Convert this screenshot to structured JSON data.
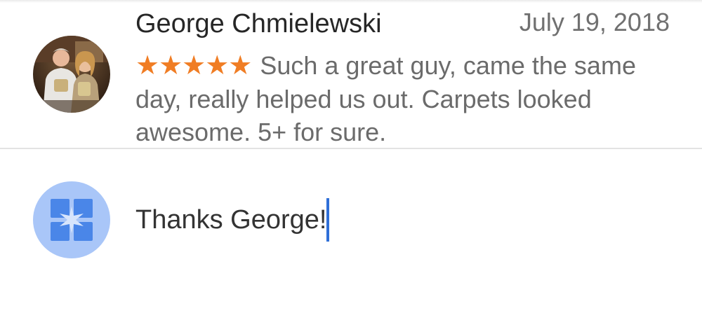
{
  "review": {
    "reviewer_name": "George Chmielewski",
    "date": "July 19, 2018",
    "rating": 5,
    "stars_text": "★★★★★",
    "body": "Such a great guy, came the same day, really helped us out.  Carpets looked awesome.  5+ for sure."
  },
  "reply": {
    "value": "Thanks George!"
  },
  "colors": {
    "star": "#f07d24",
    "caret": "#2f6fd8",
    "owner_avatar_bg": "#a9c6f8",
    "owner_avatar_icon": "#4a86e8"
  },
  "icons": {
    "reviewer_avatar": "photo-avatar",
    "owner_avatar": "business-profile-icon"
  }
}
